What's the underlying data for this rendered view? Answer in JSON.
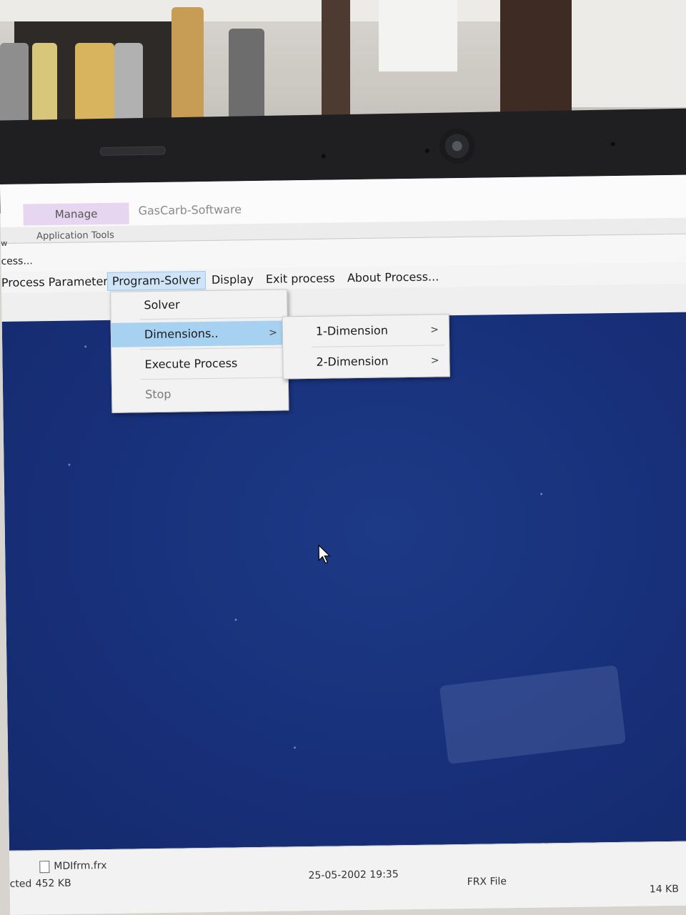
{
  "window": {
    "context_tab": "Manage",
    "app_title": "GasCarb-Software",
    "group_label": "Application Tools",
    "left_cut_label": "w",
    "mdi_caption": "cess..."
  },
  "menubar": {
    "items": [
      {
        "label": "Process Parameters"
      },
      {
        "label": "Program-Solver"
      },
      {
        "label": "Display"
      },
      {
        "label": "Exit process"
      },
      {
        "label": "About Process..."
      }
    ]
  },
  "dropdown": {
    "items": [
      {
        "label": "Solver"
      },
      {
        "label": "Dimensions..",
        "submenu_arrow": ">"
      },
      {
        "label": "Execute Process"
      },
      {
        "label": "Stop"
      }
    ]
  },
  "submenu": {
    "items": [
      {
        "label": "1-Dimension",
        "arrow": ">"
      },
      {
        "label": "2-Dimension",
        "arrow": ">"
      }
    ]
  },
  "filestrip": {
    "file_name": "MDIfrm.frx",
    "selected_label": "cted",
    "selected_size": "452 KB",
    "date": "25-05-2002 19:35",
    "type": "FRX File",
    "size": "14 KB"
  },
  "colors": {
    "desktop_blue": "#18307a",
    "menu_highlight": "#a7d1f0",
    "context_tab": "#e6d6f0"
  }
}
